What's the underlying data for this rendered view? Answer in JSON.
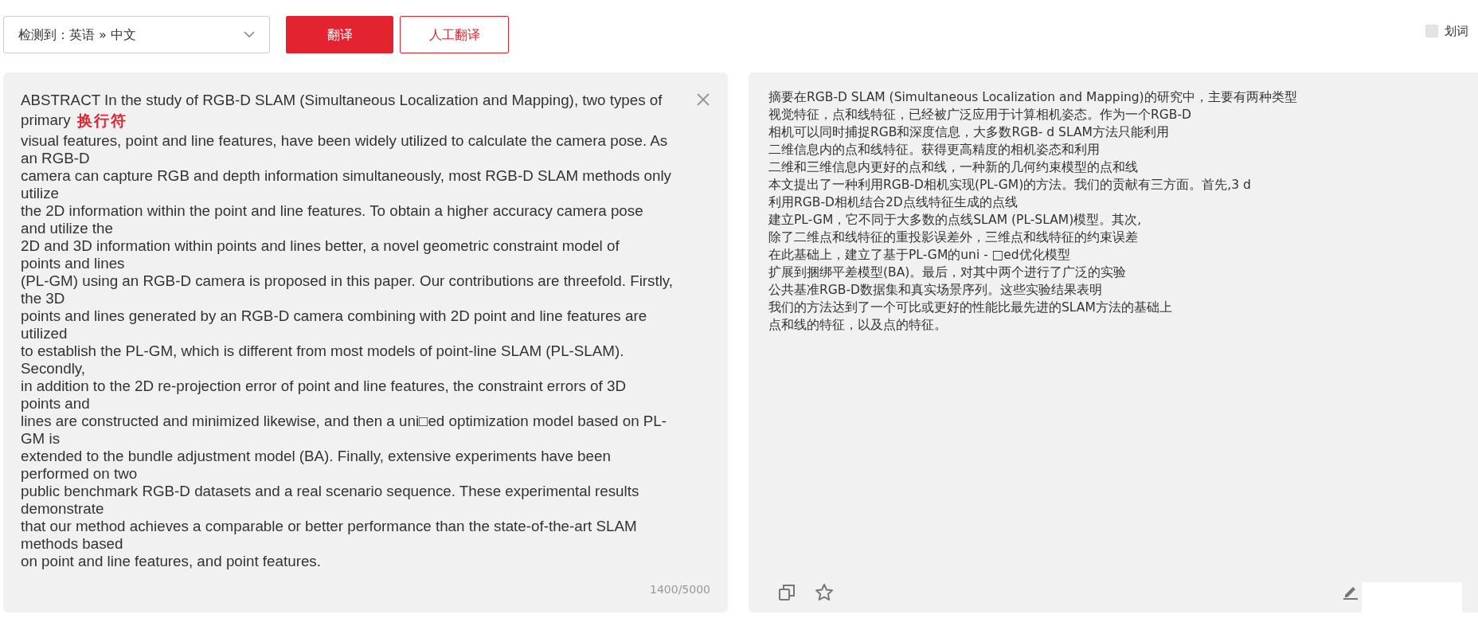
{
  "toolbar": {
    "language_select": {
      "value": "检测到：英语 » 中文"
    },
    "buttons": [
      {
        "label": "翻译",
        "kind": "primary"
      },
      {
        "label": "人工翻译",
        "kind": "outline"
      }
    ],
    "word_pick": {
      "label": "划词",
      "checked": false
    }
  },
  "source_panel": {
    "lines": [
      "ABSTRACT In the study of RGB-D SLAM (Simultaneous Localization and Mapping), two types of",
      {
        "text": "primary",
        "annotation": "换行符"
      },
      "visual features, point and line features, have been widely utilized to calculate the camera pose. As",
      "an RGB-D",
      "camera can capture RGB and depth information simultaneously, most RGB-D SLAM methods only",
      "utilize",
      "the 2D information within the point and line features. To obtain a higher accuracy camera pose",
      "and utilize the",
      "2D and 3D information within points and lines better, a novel geometric constraint model of",
      "points and lines",
      "(PL-GM) using an RGB-D camera is proposed in this paper. Our contributions are threefold. Firstly,",
      "the 3D",
      "points and lines generated by an RGB-D camera combining with 2D point and line features are",
      "utilized",
      "to establish the PL-GM, which is different from most models of point-line SLAM (PL-SLAM).",
      "Secondly,",
      "in addition to the 2D re-projection error of point and line features, the constraint errors of 3D",
      "points and",
      "lines are constructed and minimized likewise, and then a uni□ed optimization model based on PL-",
      "GM is",
      "extended to the bundle adjustment model (BA). Finally, extensive experiments have been",
      "performed on two",
      "public benchmark RGB-D datasets and a real scenario sequence. These experimental results",
      "demonstrate",
      "that our method achieves a comparable or better performance than the state-of-the-art SLAM",
      "methods based",
      "on point and line features, and point features."
    ],
    "char_count": "1400/5000"
  },
  "target_panel": {
    "lines": [
      "摘要在RGB-D SLAM (Simultaneous Localization and Mapping)的研究中，主要有两种类型",
      "视觉特征，点和线特征，已经被广泛应用于计算相机姿态。作为一个RGB-D",
      "相机可以同时捕捉RGB和深度信息，大多数RGB- d SLAM方法只能利用",
      "二维信息内的点和线特征。获得更高精度的相机姿态和利用",
      "二维和三维信息内更好的点和线，一种新的几何约束模型的点和线",
      "本文提出了一种利用RGB-D相机实现(PL-GM)的方法。我们的贡献有三方面。首先,3 d",
      "利用RGB-D相机结合2D点线特征生成的点线",
      "建立PL-GM，它不同于大多数的点线SLAM (PL-SLAM)模型。其次,",
      "除了二维点和线特征的重投影误差外，三维点和线特征的约束误差",
      "在此基础上，建立了基于PL-GM的uni - □ed优化模型",
      "扩展到捆绑平差模型(BA)。最后，对其中两个进行了广泛的实验",
      "公共基准RGB-D数据集和真实场景序列。这些实验结果表明",
      "我们的方法达到了一个可比或更好的性能比最先进的SLAM方法的基础上",
      "点和线的特征，以及点的特征。"
    ]
  }
}
